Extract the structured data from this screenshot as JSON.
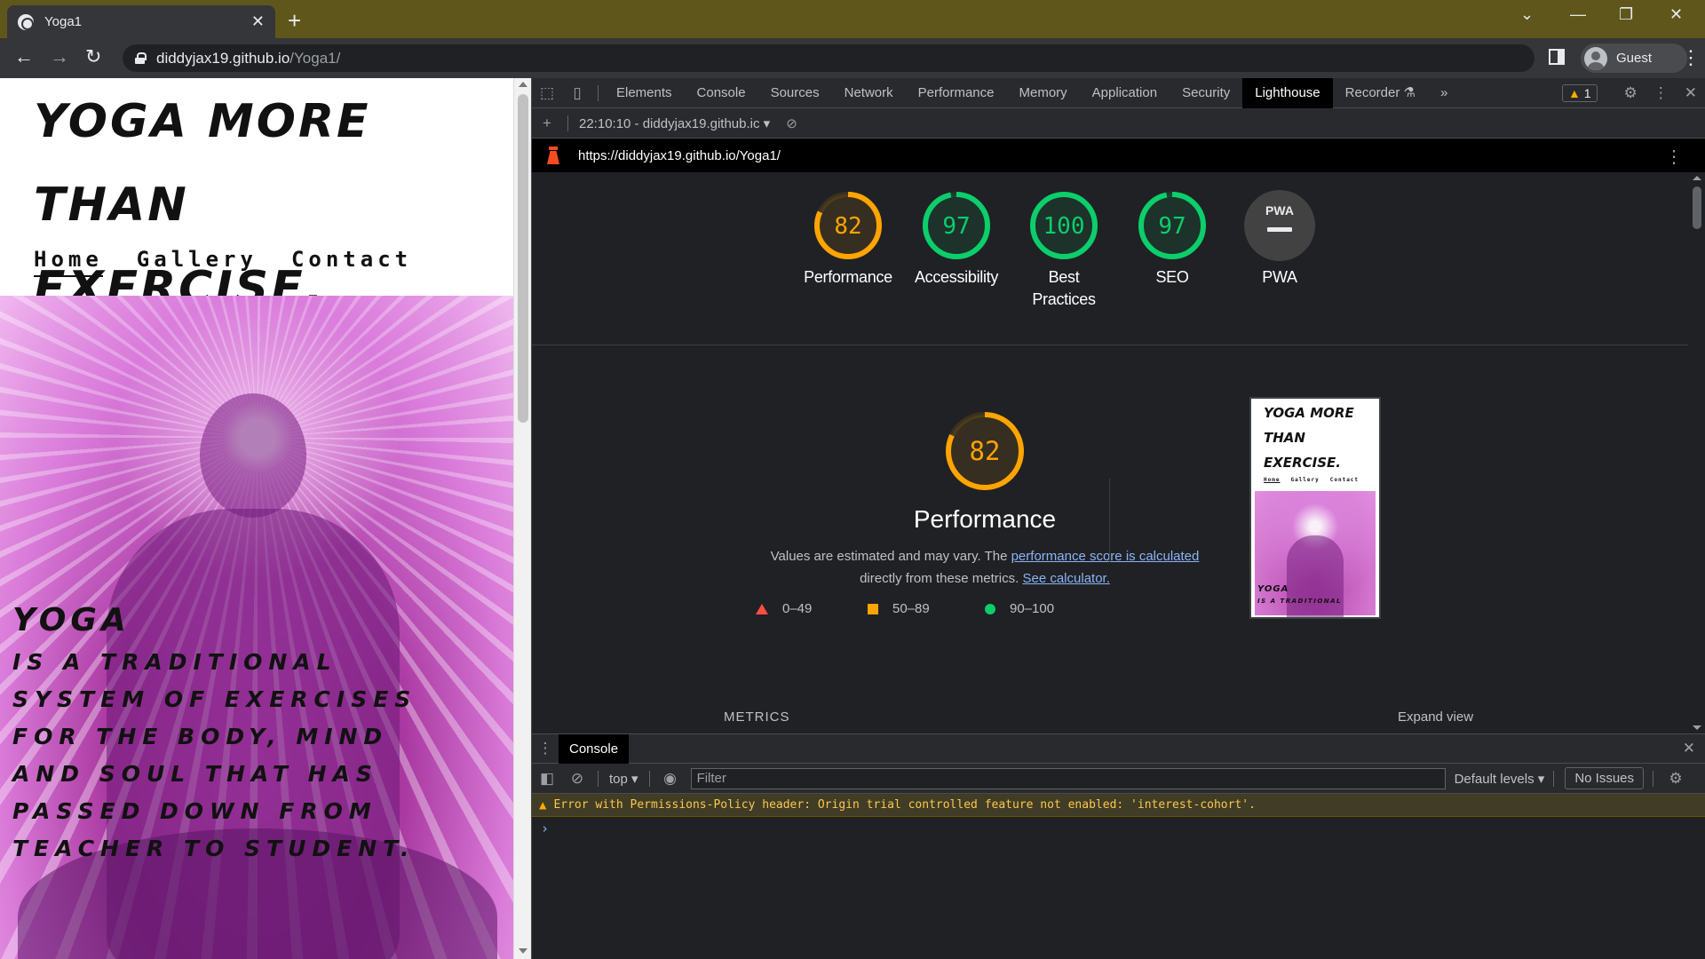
{
  "browser": {
    "tab_title": "Yoga1",
    "url_host": "diddyjax19.github.io",
    "url_path": "/Yoga1/",
    "profile_label": "Guest"
  },
  "site": {
    "title": "YOGA MORE THAN EXERCISE.",
    "nav": [
      {
        "label": "Home",
        "active": true
      },
      {
        "label": "Gallery",
        "active": false
      },
      {
        "label": "Contact",
        "active": false
      }
    ],
    "hero_heading": "YOGA",
    "hero_text": "is a traditional system of exercises for the body, mind and soul that has passed down from teacher to student."
  },
  "devtools": {
    "tabs": [
      "Elements",
      "Console",
      "Sources",
      "Network",
      "Performance",
      "Memory",
      "Application",
      "Security",
      "Lighthouse",
      "Recorder"
    ],
    "active_tab": "Lighthouse",
    "more_tabs": "»",
    "warning_count": "1",
    "report_selector": "22:10:10 - diddyjax19.github.ic",
    "report_url": "https://diddyjax19.github.io/Yoga1/"
  },
  "lighthouse": {
    "scores": [
      {
        "label": "Performance",
        "value": "82",
        "score": 82,
        "color": "#ffa400"
      },
      {
        "label": "Accessibility",
        "value": "97",
        "score": 97,
        "color": "#0cce6b"
      },
      {
        "label": "Best Practices",
        "value": "100",
        "score": 100,
        "color": "#0cce6b"
      },
      {
        "label": "SEO",
        "value": "97",
        "score": 97,
        "color": "#0cce6b"
      },
      {
        "label": "PWA",
        "value": "PWA",
        "score": null,
        "color": "#9aa0a6"
      }
    ],
    "perf_score": "82",
    "perf_score_num": 82,
    "perf_title": "Performance",
    "desc_prefix": "Values are estimated and may vary. The ",
    "desc_link1": "performance score is calculated",
    "desc_middle": " directly from these metrics. ",
    "desc_link2": "See calculator.",
    "legend": [
      "0–49",
      "50–89",
      "90–100"
    ],
    "metrics_label": "METRICS",
    "expand_label": "Expand view",
    "thumb_title": "YOGA MORE THAN EXERCISE.",
    "thumb_nav": [
      "Home",
      "Gallery",
      "Contact"
    ],
    "thumb_hero_heading": "YOGA",
    "thumb_hero_text": "is a traditional"
  },
  "console": {
    "drawer_tab": "Console",
    "context": "top",
    "filter_placeholder": "Filter",
    "levels": "Default levels",
    "issues": "No Issues",
    "message": "Error with Permissions-Policy header: Origin trial controlled feature not enabled: 'interest-cohort'.",
    "prompt": "›"
  }
}
